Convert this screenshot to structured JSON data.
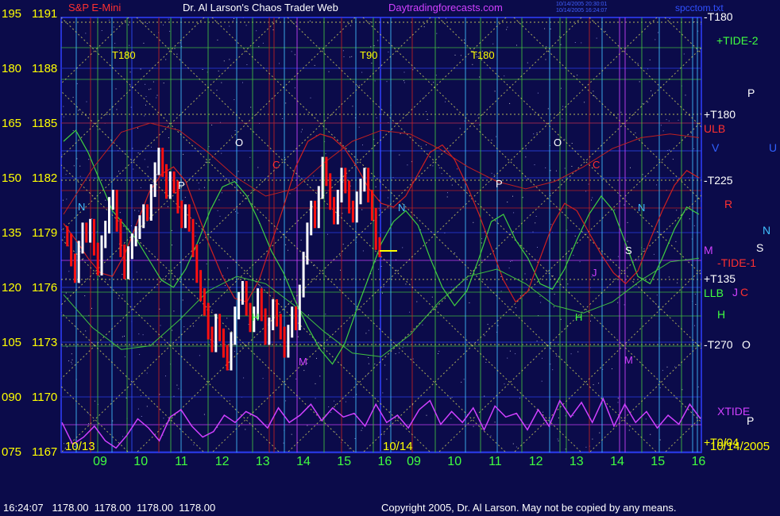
{
  "header": {
    "symbol_label": "S&P E-Mini",
    "title": "Dr. Al Larson's Chaos Trader Web",
    "site": "Daytradingforecasts.com",
    "stamp_line1": "10/14/2005 20:30:01",
    "stamp_line2": "10/14/2005 16:24:07",
    "file": "spcctom.txt"
  },
  "footer": {
    "quote": "16:24:07   1178.00  1178.00  1178.00  1178.00",
    "copyright": "Copyright 2005, Dr. Al Larson. May not be copied by any means."
  },
  "colors": {
    "background": "#0b0b4a",
    "price_up": "#ffffff",
    "price_down": "#ff1010",
    "axis_label": "#ffff00",
    "time_label": "#40ff40",
    "xtide": "#d040ff",
    "tide_green": "#40d040",
    "tide_red": "#d02020",
    "tide_grid": "#e0e060"
  },
  "chart_data": {
    "type": "line",
    "title": "Dr. Al Larson's Chaos Trader Web",
    "y_left_labels": [
      "195",
      "180",
      "165",
      "150",
      "135",
      "120",
      "105",
      "090",
      "075"
    ],
    "y_price_labels": [
      "1191",
      "1188",
      "1185",
      "1182",
      "1179",
      "1176",
      "1173",
      "1170",
      "1167"
    ],
    "ylim": [
      1167,
      1191
    ],
    "x_hour_labels": [
      "09",
      "10",
      "11",
      "12",
      "13",
      "14",
      "15",
      "16",
      "09",
      "10",
      "11",
      "12",
      "13",
      "14",
      "15",
      "16"
    ],
    "date_labels": [
      "10/13",
      "10/14"
    ],
    "date_right_label": "10/14/2005",
    "top_markers": [
      "T180",
      "T90",
      "T180"
    ],
    "right_labels": [
      {
        "text": "-T180",
        "color": "#ffffff"
      },
      {
        "text": "+TIDE-2",
        "color": "#40ff40"
      },
      {
        "text": "P",
        "color": "#ffffff"
      },
      {
        "text": "+T180",
        "color": "#ffffff"
      },
      {
        "text": "ULB",
        "color": "#ff3030"
      },
      {
        "text": "V",
        "color": "#3060ff"
      },
      {
        "text": "U",
        "color": "#3060ff"
      },
      {
        "text": "-T225",
        "color": "#ffffff"
      },
      {
        "text": "R",
        "color": "#ff3030"
      },
      {
        "text": "N",
        "color": "#40c0ff"
      },
      {
        "text": "S",
        "color": "#ffffff"
      },
      {
        "text": "M",
        "color": "#d040ff"
      },
      {
        "text": "-TIDE-1",
        "color": "#ff3030"
      },
      {
        "text": "+T135",
        "color": "#ffffff"
      },
      {
        "text": "LLB",
        "color": "#40ff40"
      },
      {
        "text": "J",
        "color": "#d040ff"
      },
      {
        "text": "C",
        "color": "#ff3030"
      },
      {
        "text": "H",
        "color": "#40ff40"
      },
      {
        "text": "-T270",
        "color": "#ffffff"
      },
      {
        "text": "O",
        "color": "#ffffff"
      },
      {
        "text": "XTIDE",
        "color": "#d040ff"
      },
      {
        "text": "P",
        "color": "#ffffff"
      },
      {
        "text": "+T0/04",
        "color": "#ffff00"
      }
    ],
    "planet_marks": [
      {
        "text": "N",
        "color": "#40c0ff"
      },
      {
        "text": "O",
        "color": "#ffffff"
      },
      {
        "text": "P",
        "color": "#ffffff"
      },
      {
        "text": "C",
        "color": "#ff3030"
      },
      {
        "text": "H",
        "color": "#40ff40"
      },
      {
        "text": "M",
        "color": "#d040ff"
      },
      {
        "text": "N",
        "color": "#40c0ff"
      },
      {
        "text": "O",
        "color": "#ffffff"
      },
      {
        "text": "P",
        "color": "#ffffff"
      },
      {
        "text": "C",
        "color": "#ff3030"
      },
      {
        "text": "N",
        "color": "#40c0ff"
      },
      {
        "text": "J",
        "color": "#d040ff"
      },
      {
        "text": "H",
        "color": "#40ff40"
      },
      {
        "text": "M",
        "color": "#d040ff"
      },
      {
        "text": "S",
        "color": "#ffffff"
      }
    ],
    "price_series": [
      1179.0,
      1178.6,
      1177.5,
      1176.6,
      1178.2,
      1179.2,
      1178.8,
      1179.4,
      1178.1,
      1177.0,
      1178.5,
      1179.3,
      1180.6,
      1181.0,
      1179.4,
      1178.0,
      1176.8,
      1177.9,
      1178.6,
      1179.0,
      1179.6,
      1180.2,
      1180.0,
      1181.3,
      1182.5,
      1183.3,
      1182.4,
      1181.2,
      1182.0,
      1181.5,
      1180.4,
      1179.6,
      1180.2,
      1179.4,
      1178.0,
      1176.6,
      1175.6,
      1174.8,
      1173.5,
      1172.8,
      1174.2,
      1173.4,
      1172.5,
      1171.8,
      1173.2,
      1174.6,
      1175.4,
      1176.0,
      1174.8,
      1173.9,
      1174.6,
      1175.6,
      1174.5,
      1173.2,
      1174.0,
      1175.0,
      1174.2,
      1173.5,
      1172.5,
      1173.6,
      1174.6,
      1174.0,
      1175.8,
      1177.6,
      1179.2,
      1180.4,
      1179.6,
      1181.2,
      1182.8,
      1181.9,
      1180.6,
      1179.8,
      1181.0,
      1182.2,
      1181.5,
      1180.4,
      1179.9,
      1180.9,
      1181.6,
      1182.2,
      1181.0,
      1180.0,
      1178.4,
      1178.0
    ],
    "xtide_series": [
      1168.6,
      1167.4,
      1167.8,
      1168.4,
      1167.6,
      1167.2,
      1167.9,
      1168.8,
      1168.3,
      1167.6,
      1168.9,
      1169.3,
      1168.4,
      1167.8,
      1168.1,
      1169.0,
      1168.6,
      1169.2,
      1168.9,
      1168.3,
      1169.4,
      1168.6,
      1169.0,
      1169.6,
      1168.7,
      1169.4,
      1168.9,
      1169.1,
      1168.4,
      1169.6,
      1168.6,
      1169.0,
      1168.3,
      1169.3,
      1169.8,
      1168.5,
      1169.2,
      1168.6,
      1169.4,
      1168.2,
      1169.5,
      1168.9,
      1169.1,
      1168.2,
      1169.3,
      1168.4,
      1169.8,
      1168.9,
      1169.7,
      1168.6,
      1169.9,
      1168.4,
      1169.6,
      1168.6,
      1169.2,
      1168.3,
      1169.0,
      1168.5,
      1169.6,
      1168.8
    ],
    "tide1_series": [
      1184.0,
      1184.6,
      1183.4,
      1181.8,
      1180.2,
      1179.4,
      1178.6,
      1177.5,
      1176.4,
      1176.0,
      1177.0,
      1178.5,
      1180.2,
      1181.5,
      1181.8,
      1181.0,
      1179.6,
      1178.0,
      1176.8,
      1175.2,
      1173.8,
      1172.6,
      1171.8,
      1172.9,
      1174.8,
      1176.6,
      1178.4,
      1179.6,
      1180.2,
      1179.4,
      1177.6,
      1176.0,
      1175.0,
      1175.8,
      1177.6,
      1179.6,
      1180.0,
      1178.6,
      1177.6,
      1176.2,
      1175.9,
      1177.0,
      1178.6,
      1180.0,
      1181.0,
      1180.2,
      1178.4,
      1176.6,
      1176.2,
      1177.6,
      1179.2,
      1180.4,
      1180.0
    ],
    "tide2_series": [
      1179.5,
      1178.6,
      1177.6,
      1176.8,
      1176.6,
      1177.8,
      1179.5,
      1181.2,
      1182.2,
      1182.6,
      1181.8,
      1180.0,
      1178.2,
      1176.6,
      1175.4,
      1175.2,
      1176.4,
      1178.4,
      1180.4,
      1182.6,
      1184.0,
      1184.4,
      1184.2,
      1183.6,
      1182.6,
      1181.4,
      1180.6,
      1180.4,
      1181.0,
      1182.2,
      1183.4,
      1183.8,
      1183.0,
      1181.6,
      1180.0,
      1178.2,
      1176.4,
      1175.2,
      1175.8,
      1177.6,
      1179.4,
      1180.6,
      1180.2,
      1179.0,
      1177.8,
      1176.8,
      1176.2,
      1176.9,
      1178.6,
      1180.2,
      1181.6,
      1182.4,
      1182.0
    ],
    "ulb_series": [
      1180.0,
      1182.5,
      1184.5,
      1185.0,
      1184.6,
      1183.4,
      1182.0,
      1181.0,
      1181.4,
      1182.8,
      1184.0,
      1184.6,
      1184.4,
      1183.6,
      1182.6,
      1181.8,
      1181.4,
      1181.8,
      1182.6,
      1183.6,
      1184.2,
      1184.4,
      1184.2
    ],
    "llb_series": [
      1175.6,
      1173.8,
      1172.6,
      1172.8,
      1174.2,
      1175.8,
      1176.6,
      1176.2,
      1175.0,
      1173.6,
      1172.4,
      1172.2,
      1173.4,
      1175.2,
      1176.6,
      1177.0,
      1176.2,
      1175.0,
      1174.6,
      1175.2,
      1176.4,
      1177.4,
      1177.6
    ]
  }
}
